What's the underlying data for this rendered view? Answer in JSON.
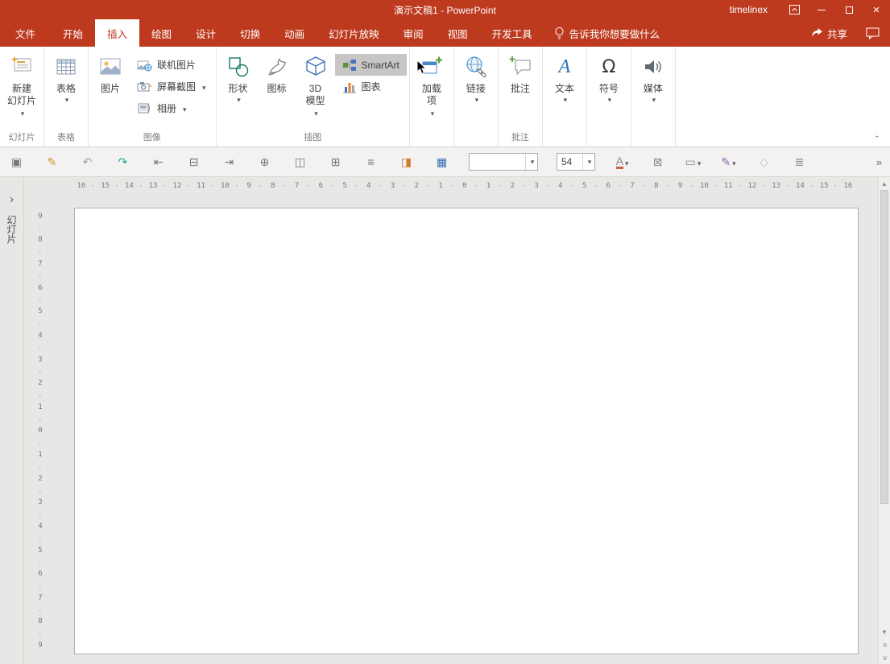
{
  "colors": {
    "accent": "#BE3A1F",
    "smartart_highlight": "#C7C6C5"
  },
  "titlebar": {
    "title": "演示文稿1 - PowerPoint",
    "user": "timelinex"
  },
  "tabs": {
    "file": "文件",
    "active_index": 1,
    "items": [
      {
        "name": "tab-home",
        "label": "开始"
      },
      {
        "name": "tab-insert",
        "label": "插入"
      },
      {
        "name": "tab-draw",
        "label": "绘图"
      },
      {
        "name": "tab-design",
        "label": "设计"
      },
      {
        "name": "tab-transitions",
        "label": "切换"
      },
      {
        "name": "tab-animations",
        "label": "动画"
      },
      {
        "name": "tab-slideshow",
        "label": "幻灯片放映"
      },
      {
        "name": "tab-review",
        "label": "审阅"
      },
      {
        "name": "tab-view",
        "label": "视图"
      },
      {
        "name": "tab-developer",
        "label": "开发工具"
      }
    ],
    "tell_me": "告诉我你想要做什么",
    "share": "共享"
  },
  "ribbon": {
    "slides": {
      "group": "幻灯片",
      "l1": "新建",
      "l2": "幻灯片"
    },
    "tables": {
      "group": "表格",
      "btn": "表格"
    },
    "images": {
      "group": "图像",
      "picture": "图片",
      "online": "联机图片",
      "screenshot": "屏幕截图",
      "album": "相册"
    },
    "illus": {
      "group": "插图",
      "shapes": "形状",
      "icons": "图标",
      "m3d1": "3D",
      "m3d2": "模型",
      "smartart": "SmartArt",
      "chart": "图表"
    },
    "addins": {
      "l1": "加载",
      "l2": "项"
    },
    "links": {
      "btn": "链接"
    },
    "comments": {
      "group": "批注",
      "btn": "批注"
    },
    "text": {
      "btn": "文本",
      "glyph": "A"
    },
    "symbols": {
      "btn": "符号",
      "glyph": "Ω"
    },
    "media": {
      "btn": "媒体"
    },
    "collapse": "ˆ"
  },
  "toolbar": {
    "icons_left": [
      {
        "name": "textbox-tool-icon",
        "glyph": "▣",
        "color": "#767676"
      },
      {
        "name": "format-painter-icon",
        "glyph": "✎",
        "color": "#C09A35"
      },
      {
        "name": "undo-icon",
        "glyph": "↶",
        "color": "#9A9A9A"
      },
      {
        "name": "redo-icon",
        "glyph": "↷",
        "color": "#17A398"
      },
      {
        "name": "align-left-icon",
        "glyph": "⇤",
        "color": "#767676"
      },
      {
        "name": "print-icon",
        "glyph": "⊟",
        "color": "#767676"
      },
      {
        "name": "align-right-icon",
        "glyph": "⇥",
        "color": "#767676"
      },
      {
        "name": "rotate-icon",
        "glyph": "⊕",
        "color": "#767676"
      },
      {
        "name": "distribute-horizontal-icon",
        "glyph": "◫",
        "color": "#767676"
      },
      {
        "name": "distribute-vertical-icon",
        "glyph": "⊞",
        "color": "#767676"
      },
      {
        "name": "align-center-icon",
        "glyph": "≡",
        "color": "#767676"
      },
      {
        "name": "color-swap-icon",
        "glyph": "◨",
        "color": "#D07A2A"
      },
      {
        "name": "table-tool-icon",
        "glyph": "▦",
        "color": "#2F6DB4"
      }
    ],
    "font_name_value": "",
    "font_size_value": "54",
    "icons_right": [
      {
        "name": "font-color-icon",
        "glyph": "A",
        "color": "#8A8A8A",
        "arrow": true
      },
      {
        "name": "char-border-icon",
        "glyph": "⊠",
        "color": "#8A8A8A",
        "arrow": false
      },
      {
        "name": "textbox-style-icon",
        "glyph": "▭",
        "color": "#8A8A8A",
        "arrow": true
      },
      {
        "name": "ink-color-icon",
        "glyph": "✎",
        "color": "#8A68B0",
        "arrow": true
      },
      {
        "name": "shape-effect-icon",
        "glyph": "◇",
        "color": "#C2C2C2",
        "arrow": false
      },
      {
        "name": "equalizer-icon",
        "glyph": "≣",
        "color": "#8A8A8A",
        "arrow": false
      }
    ],
    "overflow": "»"
  },
  "ruler": {
    "h": [
      "16",
      "15",
      "14",
      "13",
      "12",
      "11",
      "10",
      "9",
      "8",
      "7",
      "6",
      "5",
      "4",
      "3",
      "2",
      "1",
      "0",
      "1",
      "2",
      "3",
      "4",
      "5",
      "6",
      "7",
      "8",
      "9",
      "10",
      "11",
      "12",
      "13",
      "14",
      "15",
      "16"
    ],
    "v": [
      "9",
      "8",
      "7",
      "6",
      "5",
      "4",
      "3",
      "2",
      "1",
      "0",
      "1",
      "2",
      "3",
      "4",
      "5",
      "6",
      "7",
      "8",
      "9"
    ]
  },
  "slide_pane": {
    "expand_icon": "›",
    "label": "幻灯片"
  },
  "scrollbar": {
    "up": "▲",
    "down": "▼",
    "prev": "«",
    "next": "»"
  }
}
